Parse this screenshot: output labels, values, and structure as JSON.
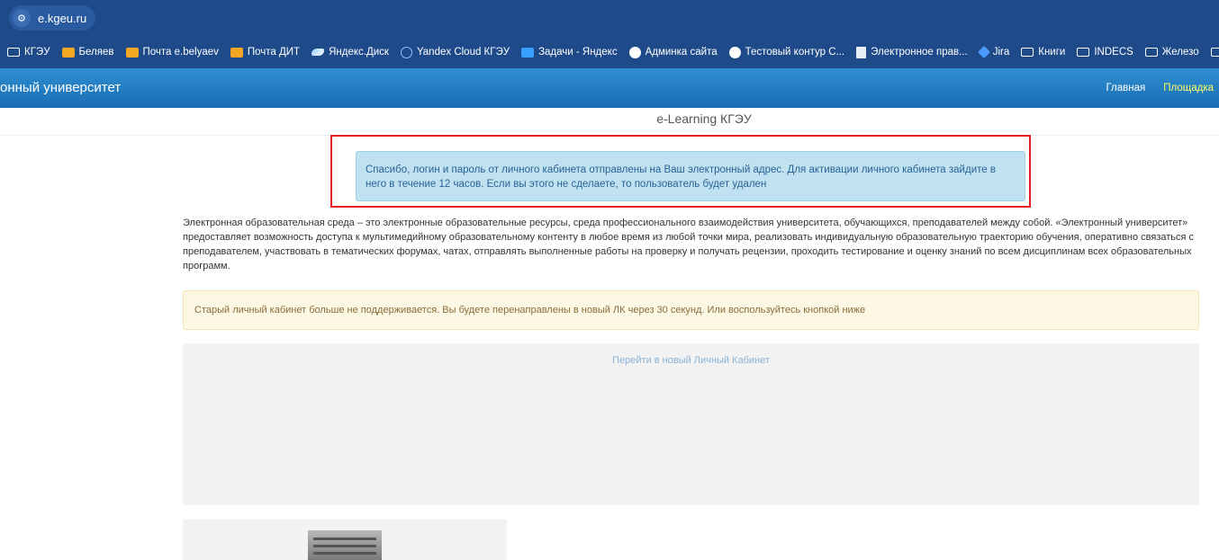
{
  "browser": {
    "url": "e.kgeu.ru"
  },
  "bookmarks": [
    {
      "label": "КГЭУ",
      "icon": "folder-icon"
    },
    {
      "label": "Беляев",
      "icon": "mail-icon"
    },
    {
      "label": "Почта e.belyaev",
      "icon": "mail-icon"
    },
    {
      "label": "Почта ДИТ",
      "icon": "mail-icon"
    },
    {
      "label": "Яндекс.Диск",
      "icon": "disk-icon"
    },
    {
      "label": "Yandex Cloud КГЭУ",
      "icon": "cloud-icon"
    },
    {
      "label": "Задачи - Яндекс",
      "icon": "tasks-icon"
    },
    {
      "label": "Админка сайта",
      "icon": "globe-icon"
    },
    {
      "label": "Тестовый контур С...",
      "icon": "globe-icon"
    },
    {
      "label": "Электронное прав...",
      "icon": "document-icon"
    },
    {
      "label": "Jira",
      "icon": "jira-icon"
    },
    {
      "label": "Книги",
      "icon": "folder-icon"
    },
    {
      "label": "INDECS",
      "icon": "folder-icon"
    },
    {
      "label": "Железо",
      "icon": "folder-icon"
    }
  ],
  "site": {
    "brand": "онный университет",
    "nav": {
      "home": "Главная",
      "playground": "Площадка"
    },
    "page_title": "e-Learning КГЭУ"
  },
  "alerts": {
    "success_line1": "Спасибо, логин и пароль от личного кабинета отправлены на Ваш электронный адрес. Для активации личного кабинета зайдите в",
    "success_line2": "него в течение 12 часов. Если вы этого не сделаете, то пользователь будет удален",
    "warning": "Старый личный кабинет больше не поддерживается. Вы будете перенаправлены в новый ЛК через 30 секунд. Или воспользуйтесь кнопкой ниже"
  },
  "description": "Электронная образовательная среда – это электронные образовательные ресурсы, среда профессионального взаимодействия университета, обучающихся, преподавателей между собой. «Электронный университет» предоставляет возможность доступа к мультимедийному образовательному контенту в любое время из любой точки мира, реализовать индивидуальную образовательную траекторию обучения, оперативно связаться с преподавателем, участвовать в тематических форумах, чатах, отправлять выполненные работы на проверку и получать рецензии, проходить тестирование и оценку знаний по всем дисциплинам всех образовательных программ.",
  "redirect": {
    "link_label": "Перейти в новый Личный Кабинет"
  }
}
